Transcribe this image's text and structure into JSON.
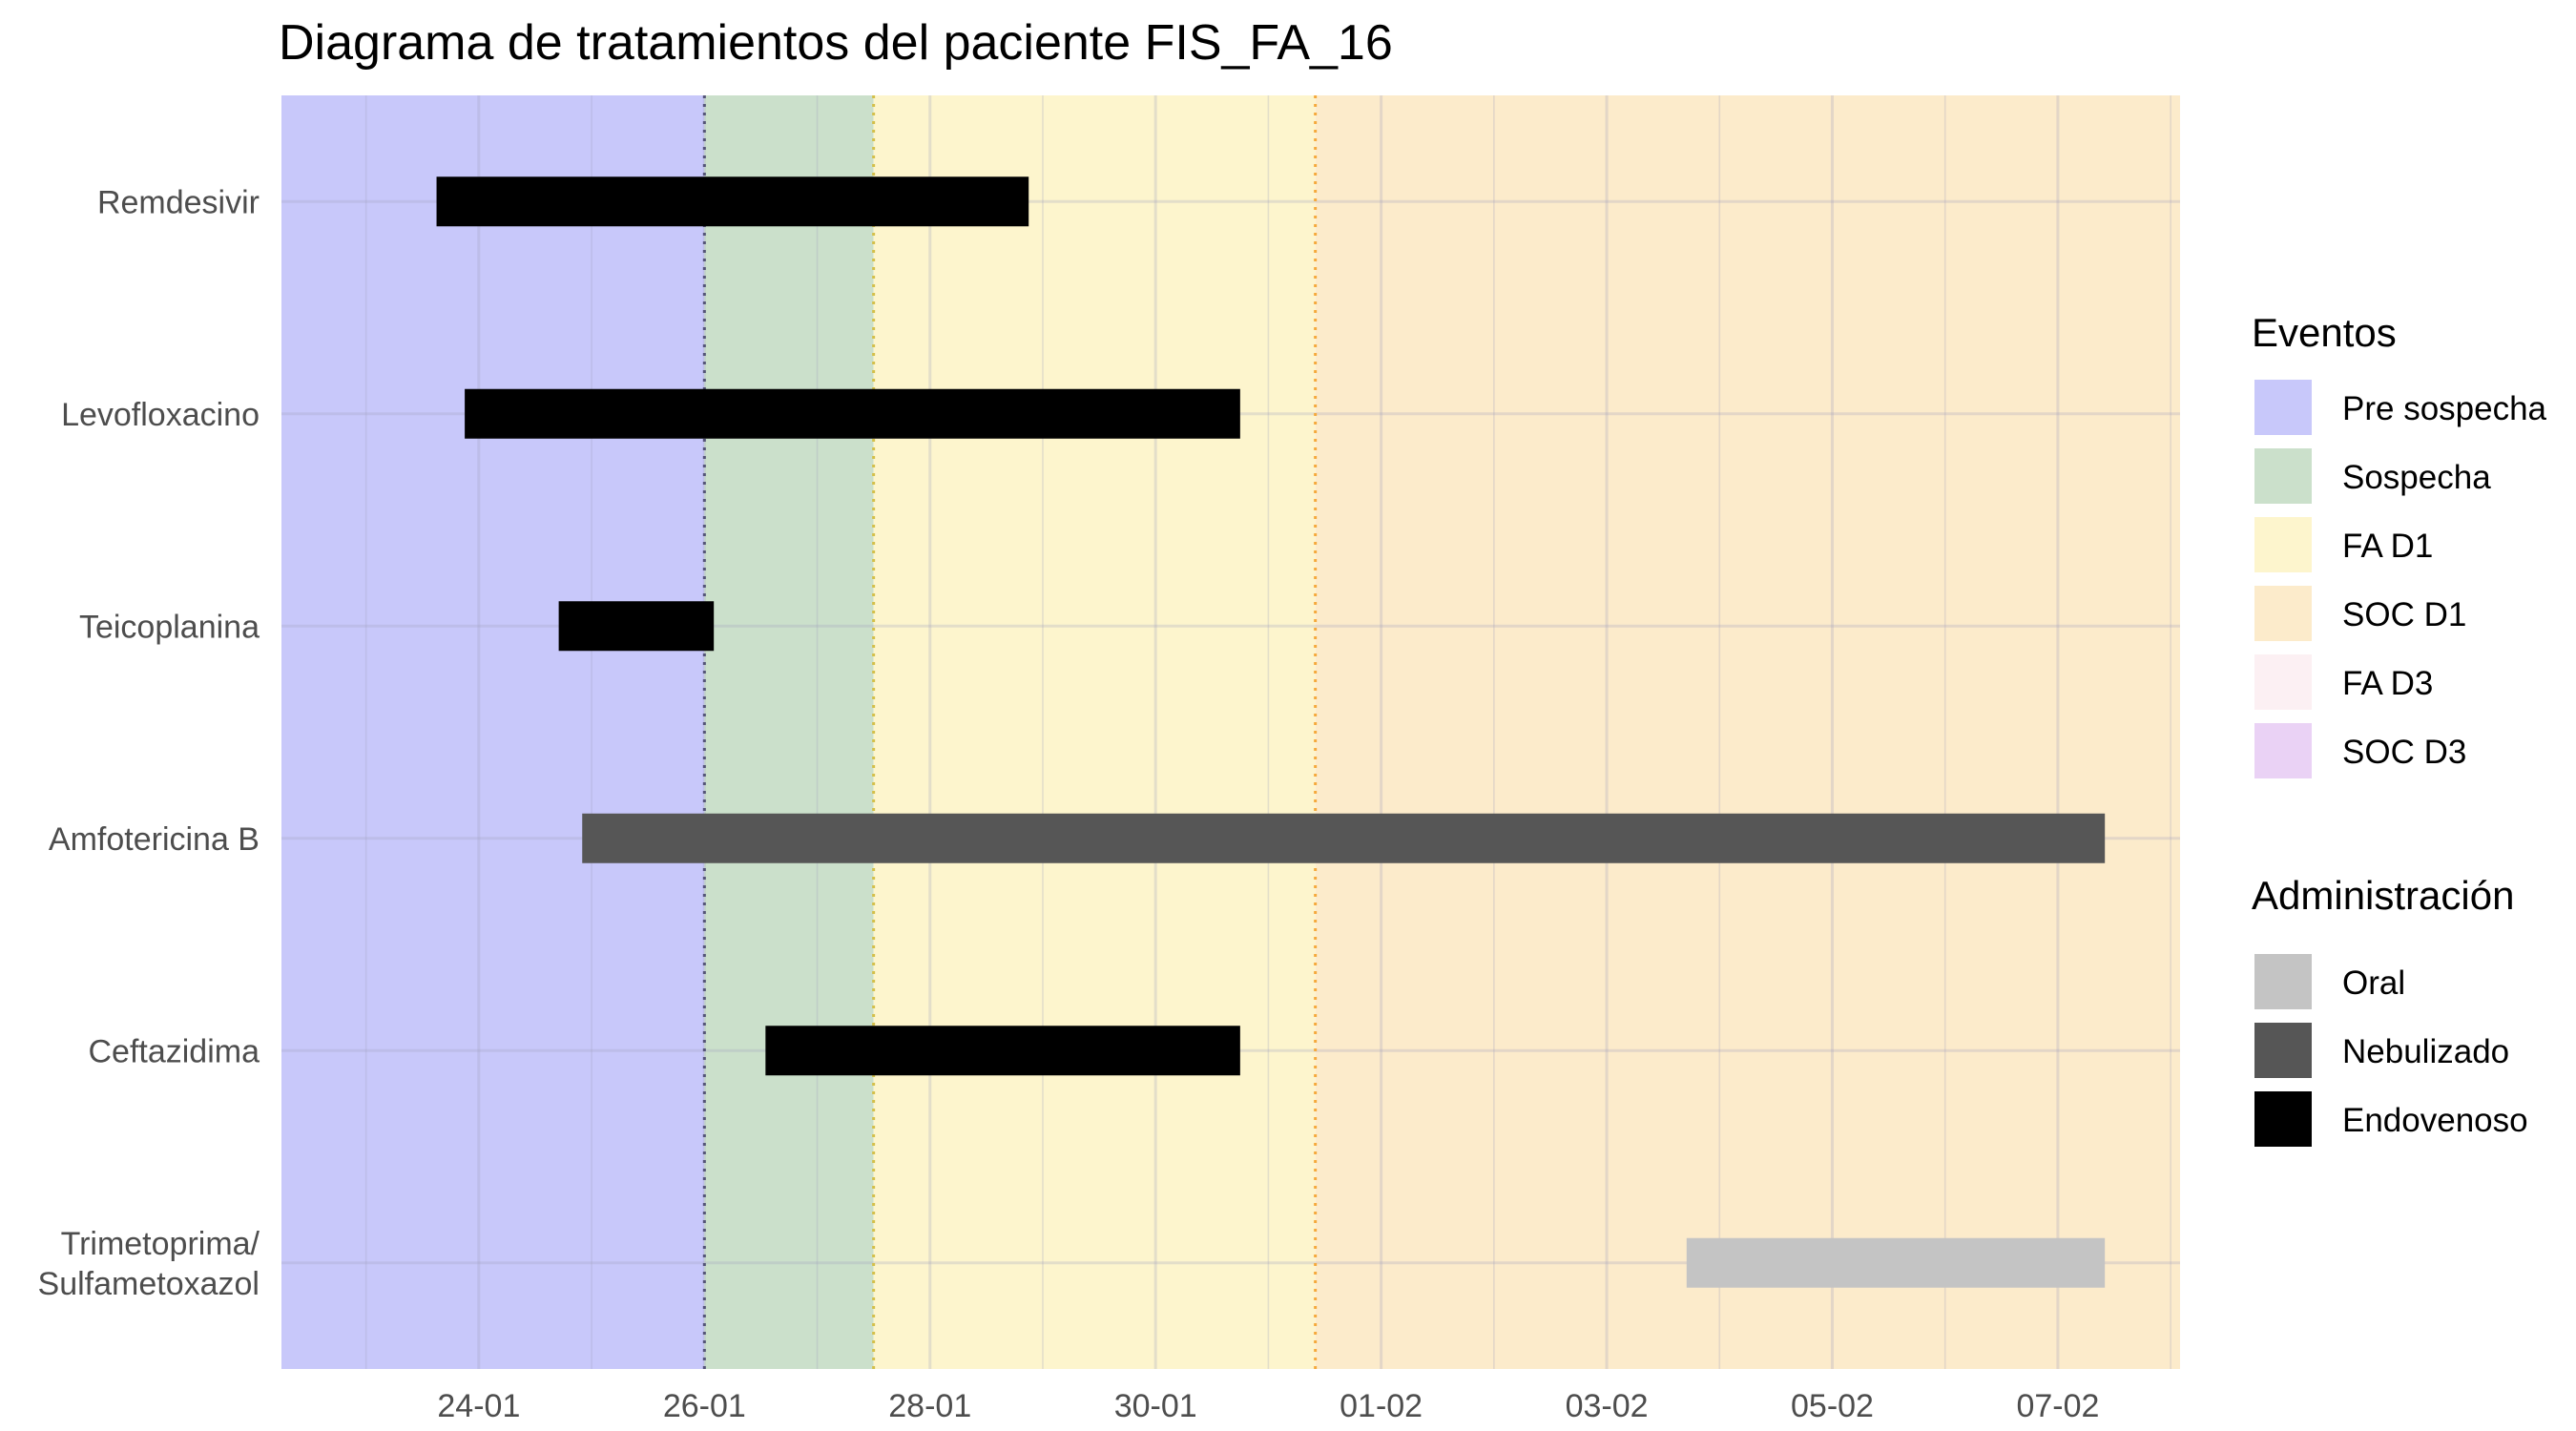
{
  "chart_data": {
    "type": "gantt",
    "title": "Diagrama de tratamientos del paciente FIS_FA_16",
    "xlabel": "",
    "ylabel": "",
    "x_axis": {
      "type": "date",
      "date_format": "DD-MM",
      "range": [
        "2021-01-22T06:00",
        "2021-02-08T02:00"
      ],
      "ticks": [
        "2021-01-24",
        "2021-01-26",
        "2021-01-28",
        "2021-01-30",
        "2021-02-01",
        "2021-02-03",
        "2021-02-05",
        "2021-02-07"
      ],
      "tick_labels": [
        "24-01",
        "26-01",
        "28-01",
        "30-01",
        "01-02",
        "03-02",
        "05-02",
        "07-02"
      ]
    },
    "categories": [
      "Remdesivir",
      "Levofloxacino",
      "Teicoplanina",
      "Amfotericina B",
      "Ceftazidima",
      "Trimetoprima/\nSulfametoxazol"
    ],
    "phases": [
      {
        "name": "Pre sospecha",
        "start": "2021-01-22T06:00",
        "end": "2021-01-26T00:00",
        "color": "#c8c8fa"
      },
      {
        "name": "Sospecha",
        "start": "2021-01-26T00:00",
        "end": "2021-01-27T12:00",
        "color": "#cbe0cb"
      },
      {
        "name": "FA D1",
        "start": "2021-01-27T12:00",
        "end": "2021-01-31T10:00",
        "color": "#fdf5cd"
      },
      {
        "name": "SOC D1",
        "start": "2021-01-31T10:00",
        "end": "2021-02-08T02:00",
        "color": "#fcebcb"
      }
    ],
    "event_lines": [
      {
        "date": "2021-01-26T00:00",
        "color": "#555577"
      },
      {
        "date": "2021-01-27T12:00",
        "color": "#d4c04a"
      },
      {
        "date": "2021-01-31T10:00",
        "color": "#f5a93c"
      }
    ],
    "series": [
      {
        "drug": "Remdesivir",
        "route": "Endovenoso",
        "start": "2021-01-23T15:00",
        "end": "2021-01-28T21:00"
      },
      {
        "drug": "Levofloxacino",
        "route": "Endovenoso",
        "start": "2021-01-23T21:00",
        "end": "2021-01-30T18:00"
      },
      {
        "drug": "Teicoplanina",
        "route": "Endovenoso",
        "start": "2021-01-24T17:00",
        "end": "2021-01-26T02:00"
      },
      {
        "drug": "Amfotericina B",
        "route": "Nebulizado",
        "start": "2021-01-24T22:00",
        "end": "2021-02-07T10:00"
      },
      {
        "drug": "Ceftazidima",
        "route": "Endovenoso",
        "start": "2021-01-26T13:00",
        "end": "2021-01-30T18:00"
      },
      {
        "drug": "Trimetoprima/\nSulfametoxazol",
        "route": "Oral",
        "start": "2021-02-03T17:00",
        "end": "2021-02-07T10:00"
      }
    ],
    "legends": [
      {
        "title": "Eventos",
        "entries": [
          {
            "label": "Pre sospecha",
            "color": "#c8c8fa"
          },
          {
            "label": "Sospecha",
            "color": "#cbe0cb"
          },
          {
            "label": "FA D1",
            "color": "#fdf5cd"
          },
          {
            "label": "SOC D1",
            "color": "#fcebcb"
          },
          {
            "label": "FA D3",
            "color": "#fcf0f3"
          },
          {
            "label": "SOC D3",
            "color": "#ead2f5"
          }
        ]
      },
      {
        "title": "Administración",
        "entries": [
          {
            "label": "Oral",
            "color": "#c4c4c4"
          },
          {
            "label": "Nebulizado",
            "color": "#565656"
          },
          {
            "label": "Endovenoso",
            "color": "#000000"
          }
        ]
      }
    ],
    "route_colors": {
      "Oral": "#c4c4c4",
      "Nebulizado": "#565656",
      "Endovenoso": "#000000"
    },
    "grid": true,
    "legend_position": "right"
  }
}
